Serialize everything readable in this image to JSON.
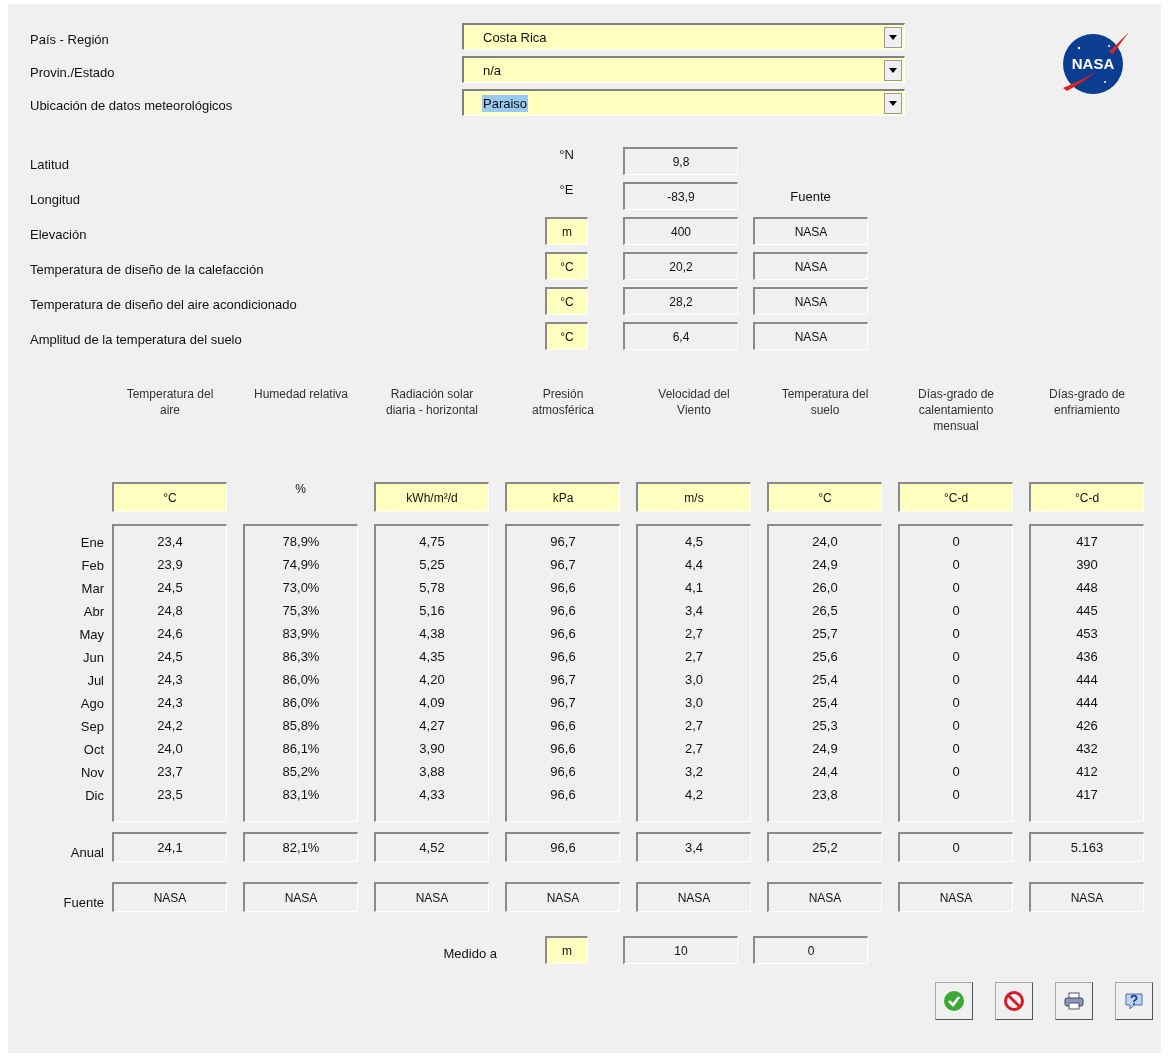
{
  "selectors": [
    {
      "label": "País - Región",
      "value": "Costa Rica",
      "highlighted": false
    },
    {
      "label": "Provin./Estado",
      "value": "n/a",
      "highlighted": false
    },
    {
      "label": "Ubicación de datos meteorológicos",
      "value": "Paraiso",
      "highlighted": true
    }
  ],
  "logo": {
    "text": "NASA"
  },
  "params": [
    {
      "label": "Latitud",
      "unit": "°N",
      "kind": "plain",
      "value": "9,8"
    },
    {
      "label": "Longitud",
      "unit": "°E",
      "kind": "plain",
      "value": "-83,9",
      "source_heading": "Fuente"
    },
    {
      "label": "Elevación",
      "unit": "m",
      "kind": "field",
      "value": "400",
      "source": "NASA"
    },
    {
      "label": "Temperatura de diseño de la calefacción",
      "unit": "°C",
      "kind": "field",
      "value": "20,2",
      "source": "NASA"
    },
    {
      "label": "Temperatura de diseño del aire acondicionado",
      "unit": "°C",
      "kind": "field",
      "value": "28,2",
      "source": "NASA"
    },
    {
      "label": "Amplitud de la temperatura del suelo",
      "unit": "°C",
      "kind": "field",
      "value": "6,4",
      "source": "NASA"
    }
  ],
  "months": [
    "Ene",
    "Feb",
    "Mar",
    "Abr",
    "May",
    "Jun",
    "Jul",
    "Ago",
    "Sep",
    "Oct",
    "Nov",
    "Dic"
  ],
  "annual_label": "Anual",
  "source_label": "Fuente",
  "columns": [
    {
      "header": "Temperatura del aire",
      "unit": "°C",
      "kind": "field",
      "monthly": [
        "23,4",
        "23,9",
        "24,5",
        "24,8",
        "24,6",
        "24,5",
        "24,3",
        "24,3",
        "24,2",
        "24,0",
        "23,7",
        "23,5"
      ],
      "annual": "24,1",
      "source": "NASA"
    },
    {
      "header": "Humedad relativa",
      "unit": "%",
      "kind": "plain",
      "monthly": [
        "78,9%",
        "74,9%",
        "73,0%",
        "75,3%",
        "83,9%",
        "86,3%",
        "86,0%",
        "86,0%",
        "85,8%",
        "86,1%",
        "85,2%",
        "83,1%"
      ],
      "annual": "82,1%",
      "source": "NASA"
    },
    {
      "header": "Radiación solar diaria - horizontal",
      "unit": "kWh/m²/d",
      "kind": "field",
      "monthly": [
        "4,75",
        "5,25",
        "5,78",
        "5,16",
        "4,38",
        "4,35",
        "4,20",
        "4,09",
        "4,27",
        "3,90",
        "3,88",
        "4,33"
      ],
      "annual": "4,52",
      "source": "NASA"
    },
    {
      "header": "Presión atmosférica",
      "unit": "kPa",
      "kind": "field",
      "monthly": [
        "96,7",
        "96,7",
        "96,6",
        "96,6",
        "96,6",
        "96,6",
        "96,7",
        "96,7",
        "96,6",
        "96,6",
        "96,6",
        "96,6"
      ],
      "annual": "96,6",
      "source": "NASA"
    },
    {
      "header": "Velocidad del Viento",
      "unit": "m/s",
      "kind": "field",
      "monthly": [
        "4,5",
        "4,4",
        "4,1",
        "3,4",
        "2,7",
        "2,7",
        "3,0",
        "3,0",
        "2,7",
        "2,7",
        "3,2",
        "4,2"
      ],
      "annual": "3,4",
      "source": "NASA"
    },
    {
      "header": "Temperatura del suelo",
      "unit": "°C",
      "kind": "field",
      "monthly": [
        "24,0",
        "24,9",
        "26,0",
        "26,5",
        "25,7",
        "25,6",
        "25,4",
        "25,4",
        "25,3",
        "24,9",
        "24,4",
        "23,8"
      ],
      "annual": "25,2",
      "source": "NASA"
    },
    {
      "header": "Días-grado de calentamiento mensual",
      "unit": "°C-d",
      "kind": "field",
      "monthly": [
        "0",
        "0",
        "0",
        "0",
        "0",
        "0",
        "0",
        "0",
        "0",
        "0",
        "0",
        "0"
      ],
      "annual": "0",
      "source": "NASA"
    },
    {
      "header": "Días-grado de enfriamiento",
      "unit": "°C-d",
      "kind": "field",
      "monthly": [
        "417",
        "390",
        "448",
        "445",
        "453",
        "436",
        "444",
        "444",
        "426",
        "432",
        "412",
        "417"
      ],
      "annual": "5.163",
      "source": "NASA"
    }
  ],
  "measured": {
    "label": "Medido a",
    "unit": "m",
    "values": [
      "10",
      "0"
    ]
  },
  "buttons": [
    {
      "kind": "ok"
    },
    {
      "kind": "cancel"
    },
    {
      "kind": "print"
    },
    {
      "kind": "help"
    }
  ]
}
